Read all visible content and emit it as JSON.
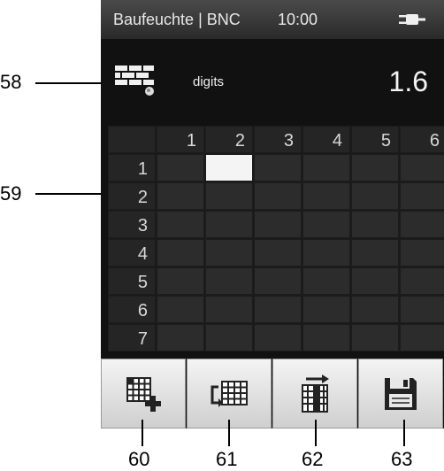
{
  "statusbar": {
    "title": "Baufeuchte | BNC",
    "time": "10:00",
    "power_icon": "plug-icon"
  },
  "info": {
    "material_icon": "brick-wall-icon",
    "unit": "digits",
    "reading": "1.6"
  },
  "grid": {
    "column_headers": [
      "1",
      "2",
      "3",
      "4",
      "5",
      "6"
    ],
    "row_headers": [
      "1",
      "2",
      "3",
      "4",
      "5",
      "6",
      "7"
    ],
    "active_cell": {
      "row": "1",
      "column": "2"
    }
  },
  "buttons": [
    {
      "icon": "grid-add-icon"
    },
    {
      "icon": "grid-extend-icon"
    },
    {
      "icon": "column-move-icon"
    },
    {
      "icon": "save-icon"
    }
  ],
  "callouts": {
    "c58": "58",
    "c59": "59",
    "c60": "60",
    "c61": "61",
    "c62": "62",
    "c63": "63"
  }
}
